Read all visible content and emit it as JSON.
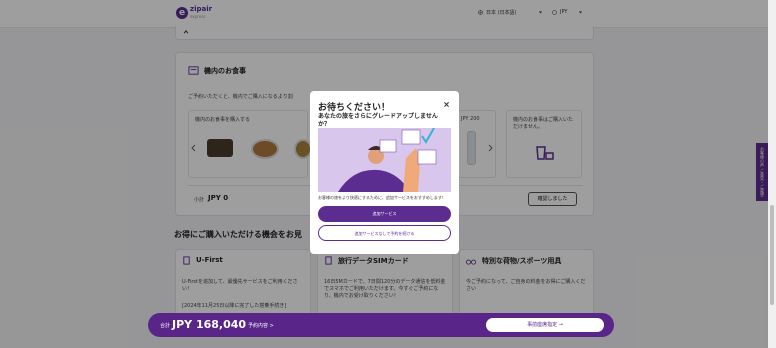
{
  "header": {
    "logo_main": "zipair",
    "logo_sub": "express",
    "language": "日本 (日本語)",
    "currency": "JPY"
  },
  "meal_section": {
    "title": "機内のお食事",
    "desc": "ご予約いただくと、機内でご購入になるより割",
    "purchase_label": "機内のお食事を購入する",
    "price_label": "JPY 200",
    "right_box_text": "機内のお食事はご購入いただけません。",
    "subtotal_label": "小計",
    "subtotal_value": "JPY 0",
    "confirm_btn": "確認しました"
  },
  "deals": {
    "heading": "お得にご購入いただける機会をお見",
    "cards": [
      {
        "title": "U-First",
        "body": "U-Firstを追加して、最優先サービスをご利用ください！",
        "extra": "[2024年11月25日以降に完了した搭乗手続き]"
      },
      {
        "title": "旅行データSIMカード",
        "body": "16日5Mカードで、7日間120分のデータ通信を低料金でスマホでご利用いただけます。今すぐご予約になり、機内でお受け取りください！",
        "extra": ""
      },
      {
        "title": "特別な荷物/スポーツ用具",
        "body": "今ご予約になって、ご自身の料金をお得にご購入ください",
        "extra": ""
      }
    ]
  },
  "sidebar_tab": "お客様の声 ご意見・ご要望",
  "modal": {
    "title": "お待ちください！",
    "subtitle": "あなたの旅をさらにグレードアップしませんか？",
    "body": "お客様の旅をより快適にするために、追加サービスをおすすめします！",
    "primary_btn": "追加サービス",
    "secondary_btn": "追加サービスなしで予約を続ける"
  },
  "bottom_bar": {
    "total_label": "合計",
    "total_value": "JPY 168,040",
    "details_link": "予約内容 >",
    "next_btn": "事前座席指定"
  },
  "colors": {
    "brand": "#5c2d91",
    "overlay": "rgba(0,0,0,0.38)"
  }
}
